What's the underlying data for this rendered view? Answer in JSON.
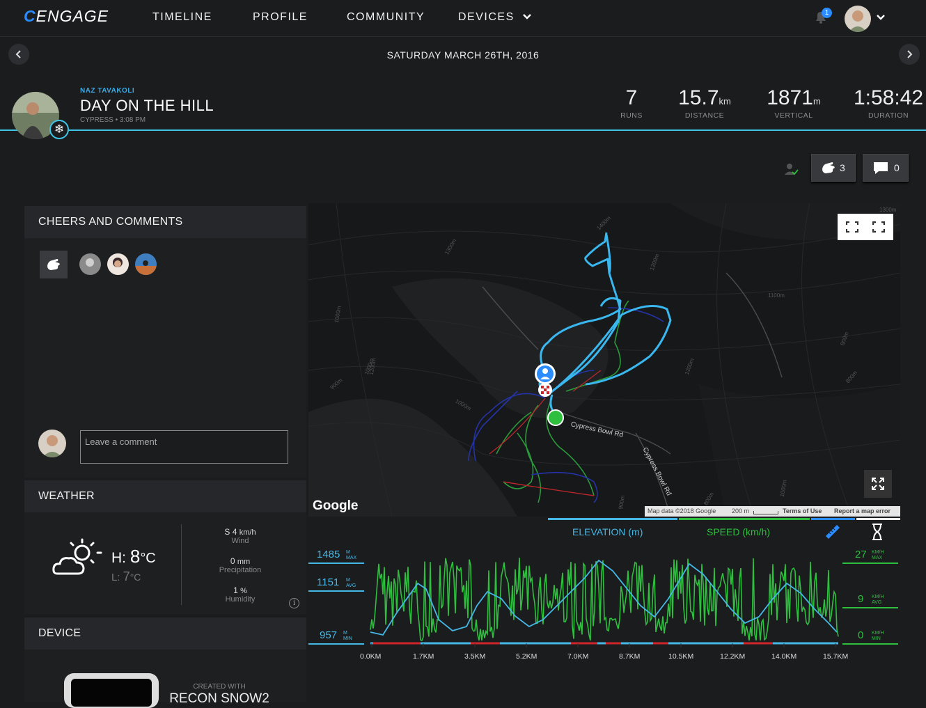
{
  "nav": {
    "logo": "ENGAGE",
    "links": [
      "TIMELINE",
      "PROFILE",
      "COMMUNITY",
      "DEVICES"
    ],
    "notifications": "1"
  },
  "datebar": {
    "date": "SATURDAY MARCH 26TH, 2016"
  },
  "activity": {
    "user": "NAZ TAVAKOLI",
    "title": "DAY ON THE HILL",
    "subtitle": "CYPRESS • 3:08 PM",
    "stats": [
      {
        "value": "7",
        "unit": "",
        "label": "RUNS"
      },
      {
        "value": "15.7",
        "unit": "km",
        "label": "DISTANCE"
      },
      {
        "value": "1871",
        "unit": "m",
        "label": "VERTICAL"
      },
      {
        "value": "1:58:42",
        "unit": "",
        "label": "DURATION"
      }
    ]
  },
  "actions": {
    "cheers_count": "3",
    "comments_count": "0"
  },
  "cheers": {
    "heading": "CHEERS AND COMMENTS",
    "comment_placeholder": "Leave a comment"
  },
  "weather": {
    "heading": "WEATHER",
    "high_label": "H:",
    "high_value": "8",
    "high_unit": "°C",
    "low_label": "L:",
    "low_value": "7",
    "low_unit": "°C",
    "wind_value": "S 4",
    "wind_unit": "km/h",
    "wind_label": "Wind",
    "precip_value": "0",
    "precip_unit": "mm",
    "precip_label": "Precipitation",
    "humidity_value": "1",
    "humidity_unit": "%",
    "humidity_label": "Humidity"
  },
  "device": {
    "heading": "DEVICE",
    "created_with": "CREATED WITH",
    "device_name": "RECON SNOW2"
  },
  "map": {
    "road1": "Cypress Bowl Rd",
    "road2": "Cypress Bowl Rd",
    "attribution": "Map data ©2018 Google",
    "scale": "200 m",
    "terms": "Terms of Use",
    "report": "Report a map error",
    "google": "Google",
    "contours": [
      "1400m",
      "1300m",
      "1200m",
      "1100m",
      "1000m",
      "1000m",
      "1000m",
      "900m",
      "900m",
      "800m",
      "800m",
      "1200m",
      "1200m",
      "800m",
      "1000m",
      "1300m"
    ]
  },
  "graph": {
    "tab_elevation": "ELEVATION (m)",
    "tab_speed": "SPEED (km/h)",
    "elev_max": "1485",
    "elev_avg": "1151",
    "elev_min": "957",
    "elev_unit": "M",
    "max_label": "MAX",
    "avg_label": "AVG",
    "min_label": "MIN",
    "speed_max": "27",
    "speed_avg": "9",
    "speed_min": "0",
    "speed_unit": "KM/H",
    "ticks": [
      "0.0KM",
      "1.7KM",
      "3.5KM",
      "5.2KM",
      "7.0KM",
      "8.7KM",
      "10.5KM",
      "12.2KM",
      "14.0KM",
      "15.7KM"
    ]
  },
  "colors": {
    "accent": "#3ec6e8",
    "elevation": "#45b8e6",
    "speed": "#2fbf3f",
    "lift": "#d0252b",
    "brand": "#2a8cff"
  }
}
